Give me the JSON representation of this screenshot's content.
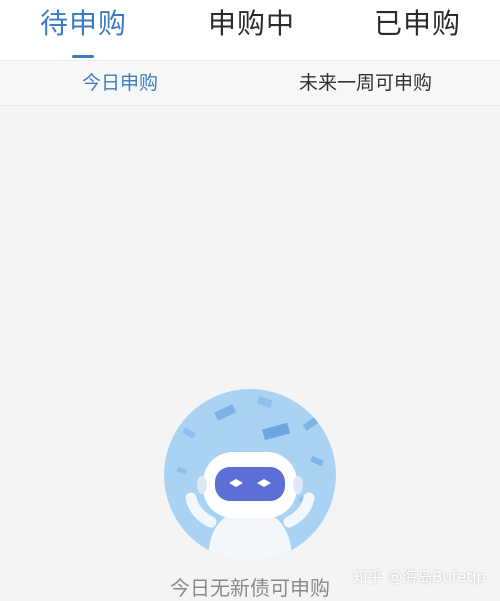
{
  "tabs": [
    {
      "label": "待申购",
      "active": true
    },
    {
      "label": "申购中",
      "active": false
    },
    {
      "label": "已申购",
      "active": false
    }
  ],
  "sub_tabs": [
    {
      "label": "今日申购",
      "active": true
    },
    {
      "label": "未来一周可申购",
      "active": false
    }
  ],
  "empty_state": {
    "message": "今日无新债可申购",
    "illustration_icon": "robot-celebrating-icon"
  },
  "watermark": {
    "text": "知乎 @海岛Bufetip"
  },
  "colors": {
    "accent": "#3e7cc0",
    "background": "#f4f4f5",
    "illustration_circle": "#a9d2f3",
    "robot_visor": "#5c6fd6"
  }
}
